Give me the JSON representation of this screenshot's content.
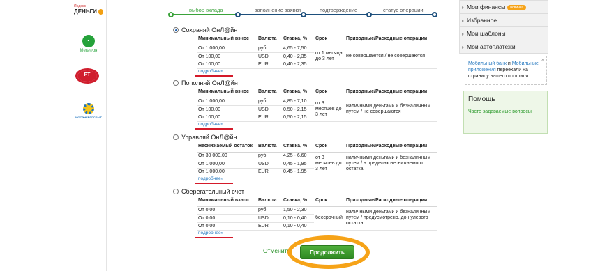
{
  "partners": {
    "yandex_small": "Яндекс",
    "yandex_big": "ДЕНЬГИ",
    "megafon": "МегаФон",
    "rt": "РТ",
    "energo": "МОСЭНЕРГОСБЫТ"
  },
  "steps": [
    "выбор вклада",
    "заполнение заявки",
    "подтверждение",
    "статус операции"
  ],
  "deposits": [
    {
      "title": "Сохраняй ОнЛ@йн",
      "selected": true,
      "headers": [
        "Минимальный взнос",
        "Валюта",
        "Ставка, %",
        "Срок",
        "Приходные/Расходные операции"
      ],
      "rows": [
        {
          "amount": "От 1 000,00",
          "currency": "руб.",
          "rate": "4,65 - 7,50"
        },
        {
          "amount": "От 100,00",
          "currency": "USD",
          "rate": "0,40 - 2,35"
        },
        {
          "amount": "От 100,00",
          "currency": "EUR",
          "rate": "0,40 - 2,35"
        }
      ],
      "term": "от 1 месяца до 3 лет",
      "operations": "не совершаются / не совершаются",
      "more": "подробнее»"
    },
    {
      "title": "Пополняй ОнЛ@йн",
      "selected": false,
      "headers": [
        "Минимальный взнос",
        "Валюта",
        "Ставка, %",
        "Срок",
        "Приходные/Расходные операции"
      ],
      "rows": [
        {
          "amount": "От 1 000,00",
          "currency": "руб.",
          "rate": "4,85 - 7,10"
        },
        {
          "amount": "От 100,00",
          "currency": "USD",
          "rate": "0,50 - 2,15"
        },
        {
          "amount": "От 100,00",
          "currency": "EUR",
          "rate": "0,50 - 2,15"
        }
      ],
      "term": "от 3 месяцев до 3 лет",
      "operations": "наличными деньгами и безналичным путем / не совершаются",
      "more": "подробнее»"
    },
    {
      "title": "Управляй ОнЛ@йн",
      "selected": false,
      "headers": [
        "Неснижаемый остаток",
        "Валюта",
        "Ставка, %",
        "Срок",
        "Приходные/Расходные операции"
      ],
      "rows": [
        {
          "amount": "От 30 000,00",
          "currency": "руб.",
          "rate": "4,25 - 6,60"
        },
        {
          "amount": "От 1 000,00",
          "currency": "USD",
          "rate": "0,45 - 1,95"
        },
        {
          "amount": "От 1 000,00",
          "currency": "EUR",
          "rate": "0,45 - 1,95"
        }
      ],
      "term": "от 3 месяцев до 3 лет",
      "operations": "наличными деньгами и безналичным путем / в пределах неснижаемого остатка",
      "more": "подробнее»"
    },
    {
      "title": "Сберегательный счет",
      "selected": false,
      "headers": [
        "Минимальный взнос",
        "Валюта",
        "Ставка, %",
        "Срок",
        "Приходные/Расходные операции"
      ],
      "rows": [
        {
          "amount": "От 0,00",
          "currency": "руб.",
          "rate": "1,50 - 2,30"
        },
        {
          "amount": "От 0,00",
          "currency": "USD",
          "rate": "0,10 - 0,40"
        },
        {
          "amount": "От 0,00",
          "currency": "EUR",
          "rate": "0,10 - 0,40"
        }
      ],
      "term": "бессрочный",
      "operations": "наличными деньгами и безналичным путем / предусмотрено, до нулевого остатка",
      "more": "подробнее»"
    }
  ],
  "actions": {
    "cancel": "Отменить",
    "continue": "Продолжить"
  },
  "sidebar": {
    "menu": [
      {
        "label": "Мои финансы",
        "badge": "новинка"
      },
      {
        "label": "Избранное"
      },
      {
        "label": "Мои шаблоны"
      },
      {
        "label": "Мои автоплатежи"
      }
    ],
    "notice": {
      "link1": "Мобильный банк",
      "and": " и ",
      "link2": "Мобильные приложения",
      "rest": " переехали на страницу вашего профиля",
      "close": "×"
    },
    "help": {
      "title": "Помощь",
      "faq": "Часто задаваемые вопросы"
    }
  },
  "colors": {
    "brand_green": "#3aa23a",
    "link_blue": "#2a7bc0",
    "highlight_orange": "#f6a318",
    "underline_red": "#d41a2a"
  }
}
